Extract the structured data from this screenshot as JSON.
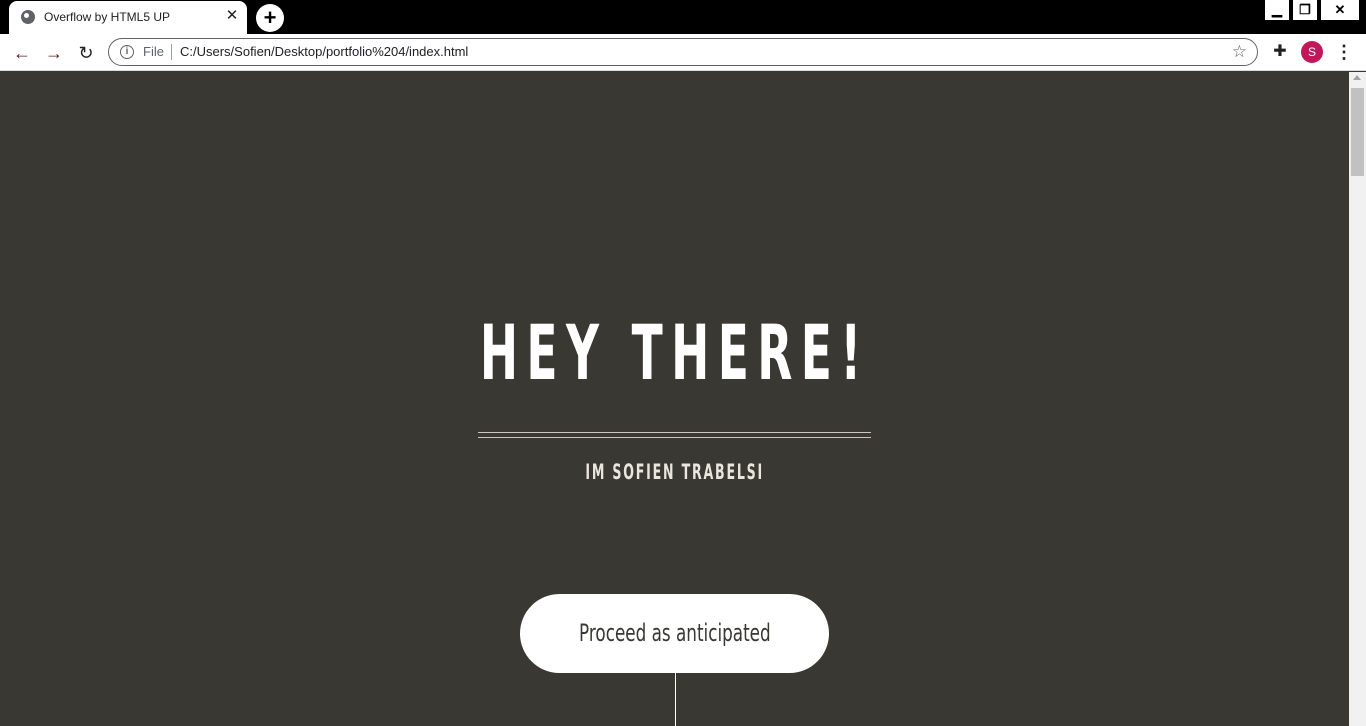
{
  "browser": {
    "tab_title": "Overflow by HTML5 UP",
    "tab_close": "✕",
    "new_tab": "+",
    "window_controls": {
      "minimize": "▁",
      "restore": "❐",
      "close": "✕"
    },
    "nav": {
      "back": "←",
      "forward": "→",
      "reload": "↻"
    },
    "info": "i",
    "scheme_label": "File",
    "url": "C:/Users/Sofien/Desktop/portfolio%204/index.html",
    "bookmark_icon": "☆",
    "extensions_icon": "✚",
    "profile_initial": "S",
    "menu_icon": "⋮"
  },
  "page": {
    "title": "HEY THERE!",
    "subtitle": "IM SOFIEN TRABELSI",
    "cta_label": "Proceed as anticipated"
  },
  "colors": {
    "background": "#393832",
    "text": "#ffffff",
    "profile": "#c2185b"
  }
}
